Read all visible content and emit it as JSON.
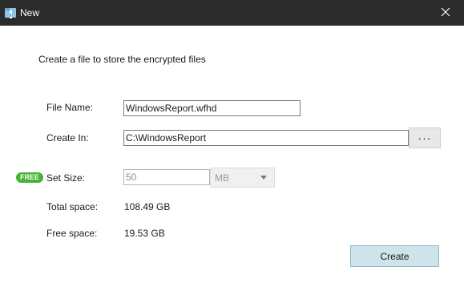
{
  "window": {
    "title": "New",
    "app_icon": "encrypted-folder-icon",
    "close_icon": "close-icon"
  },
  "dialog": {
    "intro": "Create a file to store the encrypted files",
    "file_name_label": "File Name:",
    "file_name_value": "WindowsReport.wfhd",
    "create_in_label": "Create In:",
    "create_in_value": "C:\\WindowsReport",
    "browse_label": "···",
    "free_badge": "FREE",
    "set_size_label": "Set Size:",
    "set_size_value": "50",
    "unit_value": "MB",
    "total_space_label": "Total space:",
    "total_space_value": "108.49 GB",
    "free_space_label": "Free space:",
    "free_space_value": "19.53 GB",
    "create_label": "Create"
  },
  "colors": {
    "titlebar": "#2b2b2b",
    "badge": "#45b233",
    "primary_button": "#cfe3ea"
  }
}
